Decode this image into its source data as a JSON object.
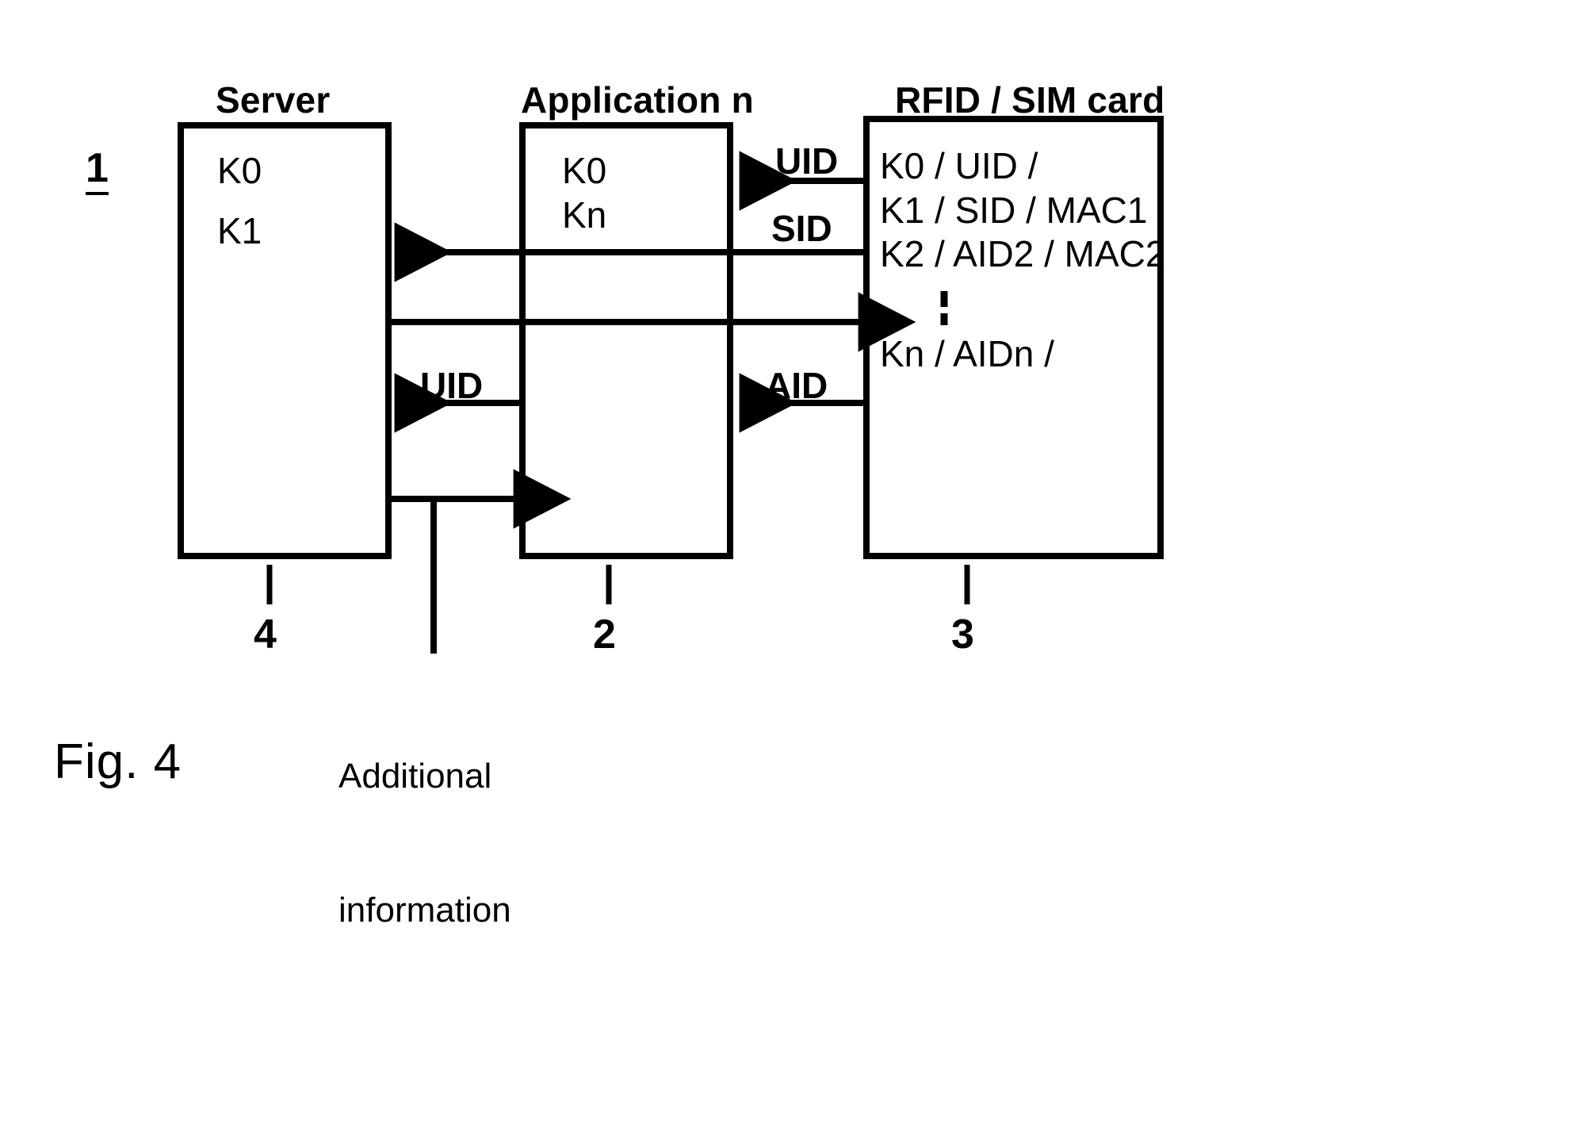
{
  "figure": {
    "caption": "Fig. 4",
    "system_ref": "1"
  },
  "boxes": [
    {
      "id": "server",
      "title": "Server",
      "ref": "4",
      "lines": [
        "K0",
        "K1"
      ]
    },
    {
      "id": "application",
      "title": "Application n",
      "ref": "2",
      "lines": [
        "K0",
        "Kn"
      ]
    },
    {
      "id": "rfid_sim_card",
      "title": "RFID / SIM card",
      "ref": "3",
      "lines": [
        "K0 / UID /",
        "K1 / SID / MAC1",
        "K2 / AID2 / MAC2",
        "Kn / AIDn /"
      ],
      "ellipsis": "vertical-dots"
    }
  ],
  "flows": [
    {
      "id": "card_to_app_uid",
      "label": "UID",
      "from": "rfid_sim_card",
      "to": "application",
      "direction": "left"
    },
    {
      "id": "card_to_server_sid",
      "label": "SID",
      "from": "rfid_sim_card",
      "to": "server",
      "direction": "left"
    },
    {
      "id": "server_to_card",
      "label": "",
      "from": "server",
      "to": "rfid_sim_card",
      "direction": "right"
    },
    {
      "id": "app_to_server_uid",
      "label": "UID",
      "from": "application",
      "to": "server",
      "direction": "left"
    },
    {
      "id": "card_to_app_aid",
      "label": "AID",
      "from": "rfid_sim_card",
      "to": "application",
      "direction": "left"
    },
    {
      "id": "addl_to_app",
      "label": "Additional information",
      "from": "additional-information",
      "to": "application",
      "direction": "right"
    }
  ],
  "annotations": {
    "additional_information_line1": "Additional",
    "additional_information_line2": "information"
  },
  "colors": {
    "stroke": "#000000",
    "background": "#ffffff"
  }
}
